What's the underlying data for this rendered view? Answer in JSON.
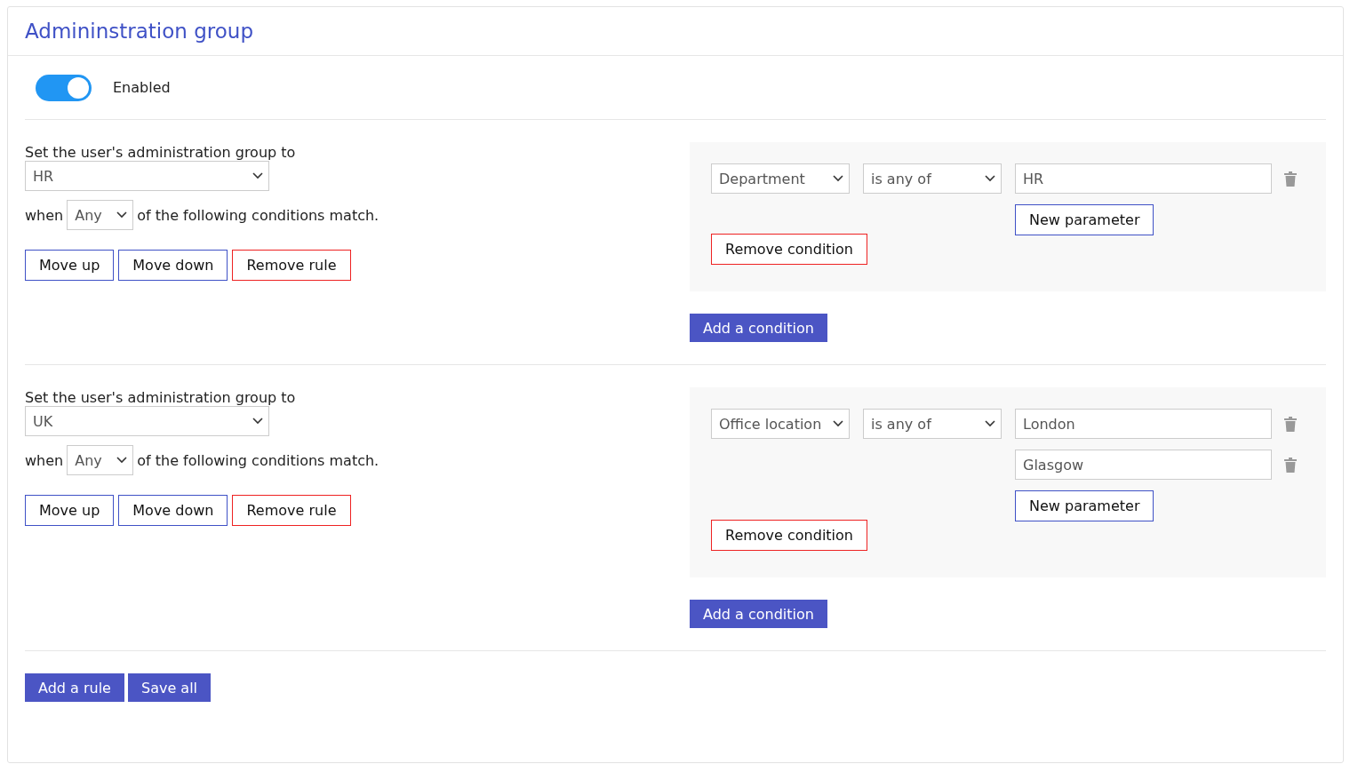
{
  "title": "Admininstration group",
  "toggle": {
    "label": "Enabled",
    "on": true
  },
  "rules": [
    {
      "heading": "Set the user's administration group to",
      "group": "HR",
      "when": "when",
      "match": "Any",
      "match_suffix": "of the following conditions match.",
      "buttons": [
        "Move up",
        "Move down",
        "Remove rule"
      ],
      "conditions": [
        {
          "field": "Department",
          "operator": "is any of",
          "values": [
            "HR"
          ],
          "new_parameter": "New parameter",
          "remove": "Remove condition"
        }
      ],
      "add_condition": "Add a condition"
    },
    {
      "heading": "Set the user's administration group to",
      "group": "UK",
      "when": "when",
      "match": "Any",
      "match_suffix": "of the following conditions match.",
      "buttons": [
        "Move up",
        "Move down",
        "Remove rule"
      ],
      "conditions": [
        {
          "field": "Office location",
          "operator": "is any of",
          "values": [
            "London",
            "Glasgow"
          ],
          "new_parameter": "New parameter",
          "remove": "Remove condition"
        }
      ],
      "add_condition": "Add a condition"
    }
  ],
  "footer_buttons": [
    "Add a rule",
    "Save all"
  ]
}
